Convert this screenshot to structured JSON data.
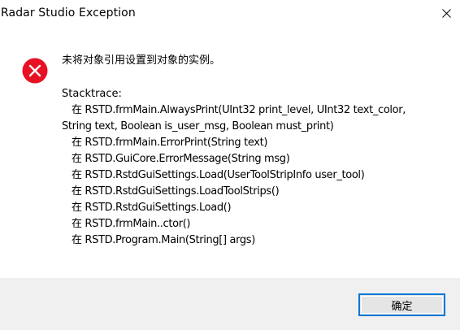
{
  "window": {
    "title": "Radar Studio Exception",
    "close_icon": "close-icon"
  },
  "dialog": {
    "icon": "error-icon",
    "message": "未将对象引用设置到对象的实例。",
    "stacktrace_header": "Stacktrace:",
    "stacktrace_lines": [
      "在 RSTD.frmMain.AlwaysPrint(UInt32 print_level, UInt32 text_color,",
      "String text, Boolean is_user_msg, Boolean must_print)",
      "在 RSTD.frmMain.ErrorPrint(String text)",
      "在 RSTD.GuiCore.ErrorMessage(String msg)",
      "在 RSTD.RstdGuiSettings.Load(UserToolStripInfo user_tool)",
      "在 RSTD.RstdGuiSettings.LoadToolStrips()",
      "在 RSTD.RstdGuiSettings.Load()",
      "在 RSTD.frmMain..ctor()",
      "在 RSTD.Program.Main(String[] args)"
    ]
  },
  "footer": {
    "ok_label": "确定"
  },
  "colors": {
    "error_red": "#e81123",
    "accent_blue": "#0078d7",
    "footer_bg": "#f0f0f0"
  }
}
